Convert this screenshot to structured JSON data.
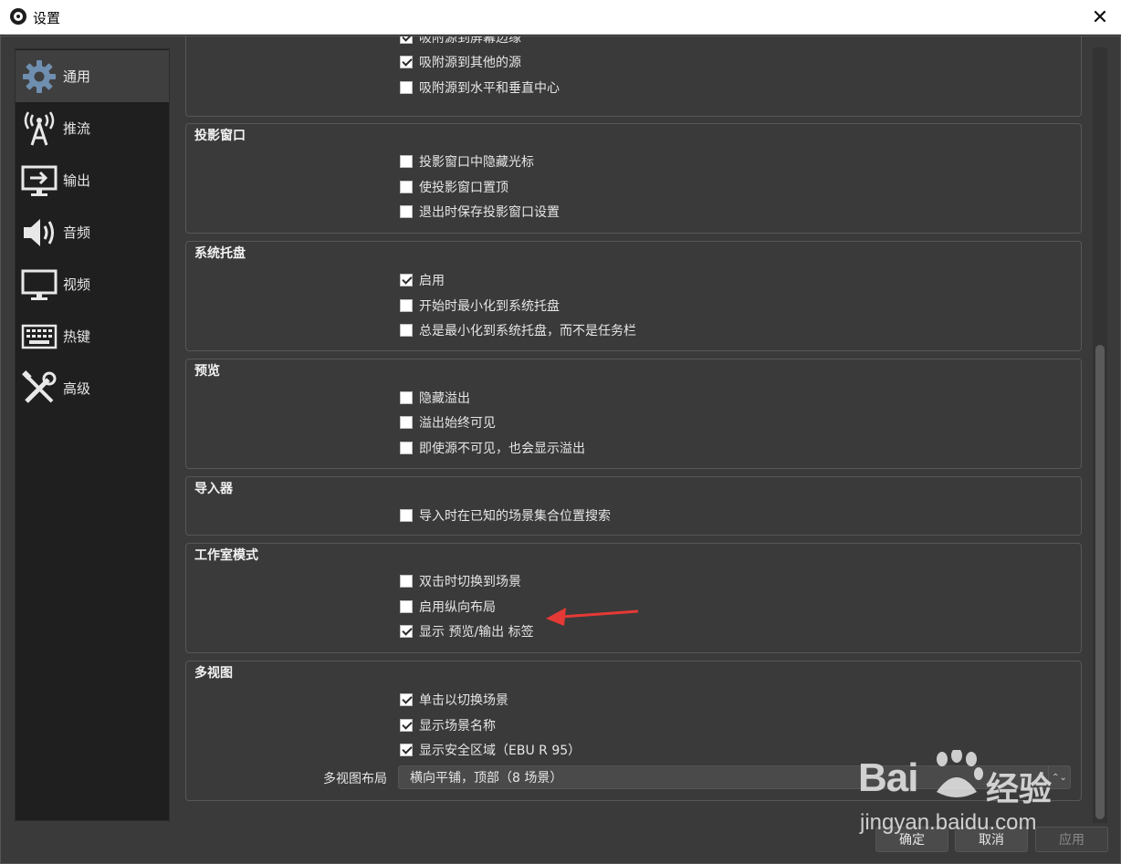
{
  "window": {
    "title": "设置",
    "close_glyph": "✕"
  },
  "sidebar": {
    "items": [
      {
        "label": "通用",
        "icon": "gear-icon",
        "active": true
      },
      {
        "label": "推流",
        "icon": "antenna-icon",
        "active": false
      },
      {
        "label": "输出",
        "icon": "output-monitor-icon",
        "active": false
      },
      {
        "label": "音频",
        "icon": "speaker-icon",
        "active": false
      },
      {
        "label": "视频",
        "icon": "monitor-icon",
        "active": false
      },
      {
        "label": "热键",
        "icon": "keyboard-icon",
        "active": false
      },
      {
        "label": "高级",
        "icon": "tools-icon",
        "active": false
      }
    ]
  },
  "groups": {
    "snapping": {
      "items": [
        {
          "label": "吸附源到屏幕边缘",
          "checked": true
        },
        {
          "label": "吸附源到其他的源",
          "checked": true
        },
        {
          "label": "吸附源到水平和垂直中心",
          "checked": false
        }
      ]
    },
    "projector": {
      "title": "投影窗口",
      "items": [
        {
          "label": "投影窗口中隐藏光标",
          "checked": false
        },
        {
          "label": "使投影窗口置顶",
          "checked": false
        },
        {
          "label": "退出时保存投影窗口设置",
          "checked": false
        }
      ]
    },
    "tray": {
      "title": "系统托盘",
      "items": [
        {
          "label": "启用",
          "checked": true
        },
        {
          "label": "开始时最小化到系统托盘",
          "checked": false
        },
        {
          "label": "总是最小化到系统托盘，而不是任务栏",
          "checked": false
        }
      ]
    },
    "preview": {
      "title": "预览",
      "items": [
        {
          "label": "隐藏溢出",
          "checked": false
        },
        {
          "label": "溢出始终可见",
          "checked": false
        },
        {
          "label": "即使源不可见，也会显示溢出",
          "checked": false
        }
      ]
    },
    "importer": {
      "title": "导入器",
      "items": [
        {
          "label": "导入时在已知的场景集合位置搜索",
          "checked": false
        }
      ]
    },
    "studio": {
      "title": "工作室模式",
      "items": [
        {
          "label": "双击时切换到场景",
          "checked": false
        },
        {
          "label": "启用纵向布局",
          "checked": false
        },
        {
          "label": "显示 预览/输出 标签",
          "checked": true
        }
      ]
    },
    "multiview": {
      "title": "多视图",
      "items": [
        {
          "label": "单击以切换场景",
          "checked": true
        },
        {
          "label": "显示场景名称",
          "checked": true
        },
        {
          "label": "显示安全区域（EBU R 95）",
          "checked": true
        }
      ],
      "layout_label": "多视图布局",
      "layout_value": "横向平铺，顶部（8 场景）"
    }
  },
  "buttons": {
    "ok": "确定",
    "cancel": "取消",
    "apply": "应用"
  },
  "watermark": {
    "brand": "Bai",
    "brand_cn": "经验",
    "url": "jingyan.baidu.com"
  },
  "colors": {
    "annotation_arrow": "#e53935",
    "panel_bg": "#3a3a3a",
    "sidebar_bg": "#1f1f1f"
  }
}
